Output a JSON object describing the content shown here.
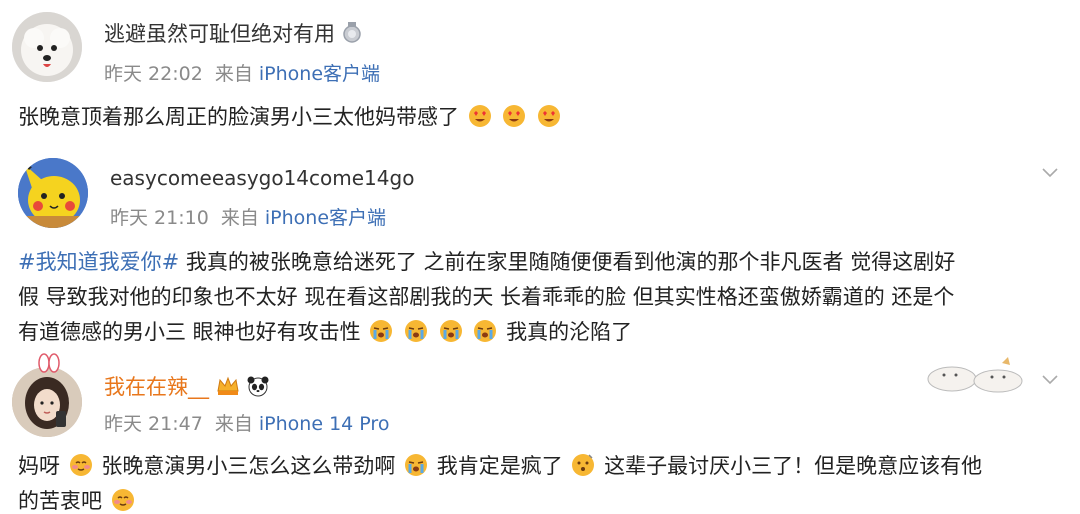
{
  "comments": [
    {
      "username": "逃避虽然可耻但绝对有用",
      "time": "昨天 22:02",
      "from": "来自",
      "source": "iPhone客户端",
      "text": "张晚意顶着那么周正的脸演男小三太他妈带感了"
    },
    {
      "username": "easycomeeasygo14come14go",
      "time": "昨天 21:10",
      "from": "来自",
      "source": "iPhone客户端",
      "topic": "#我知道我爱你#",
      "line1_rest": " 我真的被张晚意给迷死了 之前在家里随随便便看到他演的那个非凡医者 觉得这剧好",
      "line2": "假 导致我对他的印象也不太好 现在看这部剧我的天 长着乖乖的脸 但其实性格还蛮傲娇霸道的 还是个",
      "line3": "有道德感的男小三 眼神也好有攻击性",
      "line3_end": "我真的沦陷了"
    },
    {
      "username": "我在在辣__",
      "time": "昨天 21:47",
      "from": "来自",
      "source": "iPhone 14 Pro",
      "seg1": "妈呀",
      "seg2": "张晚意演男小三怎么这么带劲啊",
      "seg3": "我肯定是疯了",
      "seg4": " 这辈子最讨厌小三了！但是晚意应该有他",
      "line2": "的苦衷吧"
    }
  ],
  "colors": {
    "link": "#3d6fb5",
    "meta": "#8a8a8a",
    "username": "#333333"
  }
}
